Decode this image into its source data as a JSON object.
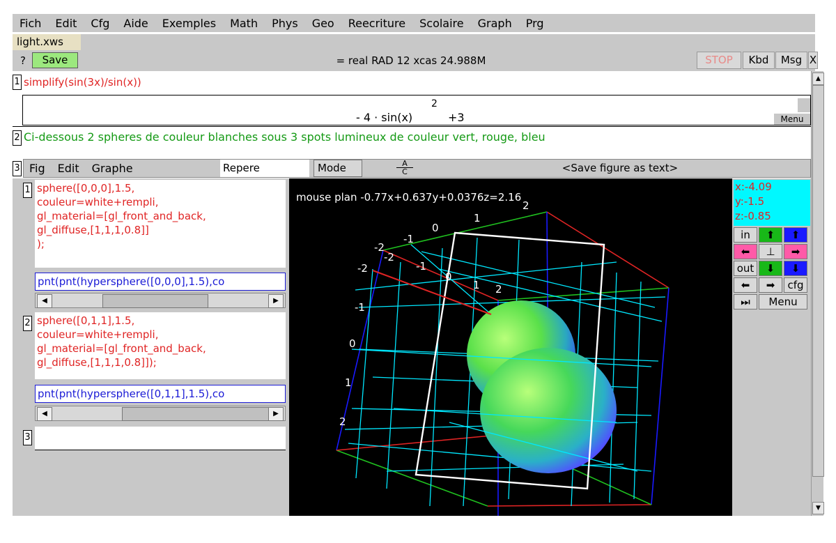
{
  "menu": [
    "Fich",
    "Edit",
    "Cfg",
    "Aide",
    "Exemples",
    "Math",
    "Phys",
    "Geo",
    "Reecriture",
    "Scolaire",
    "Graph",
    "Prg"
  ],
  "file_tab": "light.xws",
  "toolbar": {
    "help": "?",
    "save": "Save",
    "status": "= real RAD 12 xcas 24.988M",
    "stop": "STOP",
    "kbd": "Kbd",
    "msg": "Msg",
    "close": "X"
  },
  "levels": {
    "l1": {
      "num": "1",
      "input": "simplify(sin(3x)/sin(x))",
      "output": "- 4 · sin(x)",
      "output_exp": "2",
      "output_tail": "+3",
      "menu": "Menu"
    },
    "l2": {
      "num": "2",
      "comment": "Ci-dessous 2 spheres de couleur blanches sous 3 spots lumineux de couleur vert, rouge, bleu"
    },
    "l3": {
      "num": "3"
    }
  },
  "geo": {
    "menus": [
      "Fig",
      "Edit",
      "Graphe"
    ],
    "repere": "Repere",
    "mode": "Mode",
    "save_fig": "<Save figure as text>",
    "fraction_top": "A",
    "fraction_bottom": "C"
  },
  "entries": [
    {
      "num": "1",
      "lines": [
        "sphere([0,0,0],1.5,",
        "couleur=white+rempli,",
        "gl_material=[gl_front_and_back,",
        "gl_diffuse,[1,1,1,0.8]]",
        ");"
      ],
      "result": "pnt(pnt(hypersphere([0,0,0],1.5),co"
    },
    {
      "num": "2",
      "lines": [
        "sphere([0,1,1],1.5,",
        "couleur=white+rempli,",
        "gl_material=[gl_front_and_back,",
        "gl_diffuse,[1,1,1,0.8]]);"
      ],
      "result": "pnt(pnt(hypersphere([0,1,1],1.5),co"
    },
    {
      "num": "3",
      "lines": [],
      "result": ""
    }
  ],
  "plot": {
    "mouse_plan": "mouse plan -0.77x+0.637y+0.0376z=2.16",
    "tick_labels": [
      "2",
      "1",
      "0",
      "-1",
      "-2",
      "-2",
      "-2",
      "-1",
      "0",
      "1",
      "2",
      "-1",
      "0",
      "1",
      "2"
    ]
  },
  "coords": {
    "x": "x:-4.09",
    "y": "y:-1.5",
    "z": "z:-0.85"
  },
  "nav": {
    "in": "in",
    "out": "out",
    "cfg": "cfg",
    "menu": "Menu"
  },
  "colors": {
    "menubar": "#c8c8c8",
    "input_red": "#e02424",
    "comment_green": "#159a15",
    "result_blue": "#1a1ad6",
    "save_green": "#9ce87e",
    "coords_cyan": "#00f8ff",
    "nav_green": "#18b818",
    "nav_blue": "#1a1aff",
    "nav_pink": "#ff5aa8"
  }
}
